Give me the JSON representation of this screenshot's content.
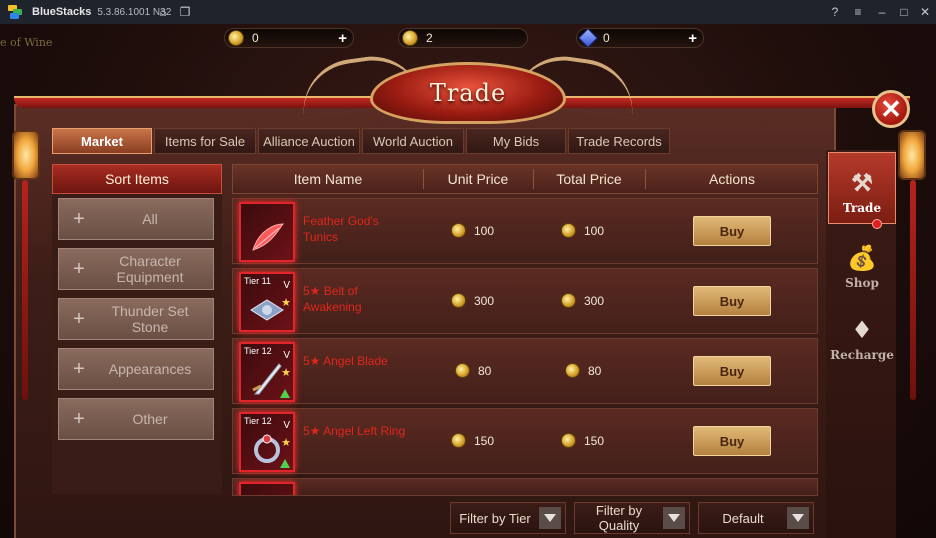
{
  "emulator": {
    "title": "BlueStacks",
    "version": "5.3.86.1001 N32",
    "icons": [
      "home-icon",
      "multi-instance-icon",
      "help-icon",
      "menu-icon",
      "minimize-icon",
      "maximize-icon",
      "close-icon"
    ]
  },
  "scene": {
    "background_text": "e of Wine"
  },
  "currency": [
    {
      "icon": "gold-coin-icon",
      "value": "0"
    },
    {
      "icon": "gold-bag-icon",
      "value": "2"
    },
    {
      "icon": "gem-icon",
      "value": "0"
    }
  ],
  "header": {
    "title": "Trade"
  },
  "tabs": [
    {
      "label": "Market",
      "active": true
    },
    {
      "label": "Items for Sale",
      "active": false
    },
    {
      "label": "Alliance Auction",
      "active": false
    },
    {
      "label": "World Auction",
      "active": false
    },
    {
      "label": "My Bids",
      "active": false
    },
    {
      "label": "Trade Records",
      "active": false
    }
  ],
  "sort": {
    "title": "Sort Items",
    "items": [
      {
        "line1": "All",
        "line2": ""
      },
      {
        "line1": "Character",
        "line2": "Equipment"
      },
      {
        "line1": "Thunder Set",
        "line2": "Stone"
      },
      {
        "line1": "Appearances",
        "line2": ""
      },
      {
        "line1": "Other",
        "line2": ""
      }
    ]
  },
  "table": {
    "columns": [
      "Item Name",
      "Unit Price",
      "Total Price",
      "Actions"
    ],
    "rows": [
      {
        "tier": "",
        "name_line1": "Feather God's",
        "name_line2": "Tunics",
        "unit_price": "100",
        "total_price": "100",
        "action": "Buy"
      },
      {
        "tier": "Tier 11",
        "name_line1": "5★ Belt of",
        "name_line2": "Awakening",
        "unit_price": "300",
        "total_price": "300",
        "action": "Buy"
      },
      {
        "tier": "Tier 12",
        "name_line1": "5★ Angel Blade",
        "name_line2": "",
        "unit_price": "80",
        "total_price": "80",
        "action": "Buy"
      },
      {
        "tier": "Tier 12",
        "name_line1": "5★ Angel Left Ring",
        "name_line2": "",
        "unit_price": "150",
        "total_price": "150",
        "action": "Buy"
      }
    ]
  },
  "filters": [
    {
      "line1": "Filter by Tier",
      "line2": ""
    },
    {
      "line1": "Filter by",
      "line2": "Quality"
    },
    {
      "line1": "Default",
      "line2": ""
    }
  ],
  "side_nav": [
    {
      "label": "Trade",
      "icon": "gavel-icon",
      "active": true
    },
    {
      "label": "Shop",
      "icon": "money-bag-icon",
      "active": false
    },
    {
      "label": "Recharge",
      "icon": "recharge-bag-icon",
      "active": false
    }
  ],
  "colors": {
    "accent_red": "#a82d21",
    "gold": "#e2b978",
    "item_name_red": "#e0261c"
  }
}
